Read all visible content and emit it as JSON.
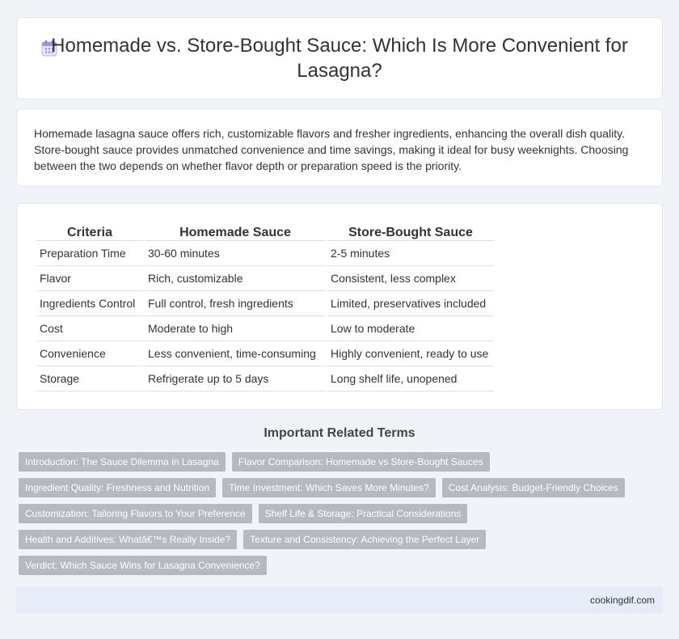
{
  "header": {
    "title": "Homemade vs. Store-Bought Sauce: Which Is More Convenient for Lasagna?",
    "icon": "calendar-icon"
  },
  "summary": {
    "text": "Homemade lasagna sauce offers rich, customizable flavors and fresher ingredients, enhancing the overall dish quality. Store-bought sauce provides unmatched convenience and time savings, making it ideal for busy weeknights. Choosing between the two depends on whether flavor depth or preparation speed is the priority."
  },
  "table": {
    "headers": [
      "Criteria",
      "Homemade Sauce",
      "Store-Bought Sauce"
    ],
    "rows": [
      [
        "Preparation Time",
        "30-60 minutes",
        "2-5 minutes"
      ],
      [
        "Flavor",
        "Rich, customizable",
        "Consistent, less complex"
      ],
      [
        "Ingredients Control",
        "Full control, fresh ingredients",
        "Limited, preservatives included"
      ],
      [
        "Cost",
        "Moderate to high",
        "Low to moderate"
      ],
      [
        "Convenience",
        "Less convenient, time-consuming",
        "Highly convenient, ready to use"
      ],
      [
        "Storage",
        "Refrigerate up to 5 days",
        "Long shelf life, unopened"
      ]
    ]
  },
  "related": {
    "heading": "Important Related Terms",
    "tags": [
      "Introduction: The Sauce Dilemma in Lasagna",
      "Flavor Comparison: Homemade vs Store-Bought Sauces",
      "Ingredient Quality: Freshness and Nutrition",
      "Time Investment: Which Saves More Minutes?",
      "Cost Analysis: Budget-Friendly Choices",
      "Customization: Tailoring Flavors to Your Preference",
      "Shelf Life & Storage: Practical Considerations",
      "Health and Additives: Whatâ€™s Really Inside?",
      "Texture and Consistency: Achieving the Perfect Layer",
      "Verdict: Which Sauce Wins for Lasagna Convenience?"
    ]
  },
  "footer": {
    "text": "cookingdif.com"
  }
}
